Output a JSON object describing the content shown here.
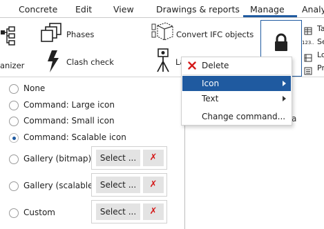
{
  "menubar": {
    "tabs": [
      "Concrete",
      "Edit",
      "View",
      "Drawings & reports",
      "Manage",
      "Analy"
    ],
    "active_tab": "Manage",
    "accent_color": "#1f5aa0"
  },
  "ribbon": {
    "organizer_label": "anizer",
    "phases_label": "Phases",
    "clash_check_label": "Clash check",
    "convert_ifc_label": "Convert IFC objects",
    "layout_label": "La",
    "side_list": [
      "Ta",
      "Se",
      "Lo",
      "Pr"
    ],
    "side_icon_text": "123.."
  },
  "context_menu": {
    "items": [
      {
        "label": "Delete",
        "icon": "red-x-icon"
      },
      {
        "label": "Icon",
        "submenu": true,
        "highlighted": true
      },
      {
        "label": "Text",
        "submenu": true
      },
      {
        "label": "Change command..."
      }
    ],
    "highlight_color": "#1f5aa0"
  },
  "options": {
    "choices": [
      {
        "label": "None",
        "checked": false
      },
      {
        "label": "Command: Large icon",
        "checked": false
      },
      {
        "label": "Command: Small icon",
        "checked": false
      },
      {
        "label": "Command: Scalable icon",
        "checked": true
      },
      {
        "label": "Gallery (bitmap)",
        "checked": false,
        "select": "Select ...",
        "clear": "✗"
      },
      {
        "label": "Gallery (scalable)",
        "checked": false,
        "select": "Select ...",
        "clear": "✗"
      },
      {
        "label": "Custom",
        "checked": false,
        "select": "Select ...",
        "clear": "✗"
      }
    ]
  },
  "stray_text": "a"
}
